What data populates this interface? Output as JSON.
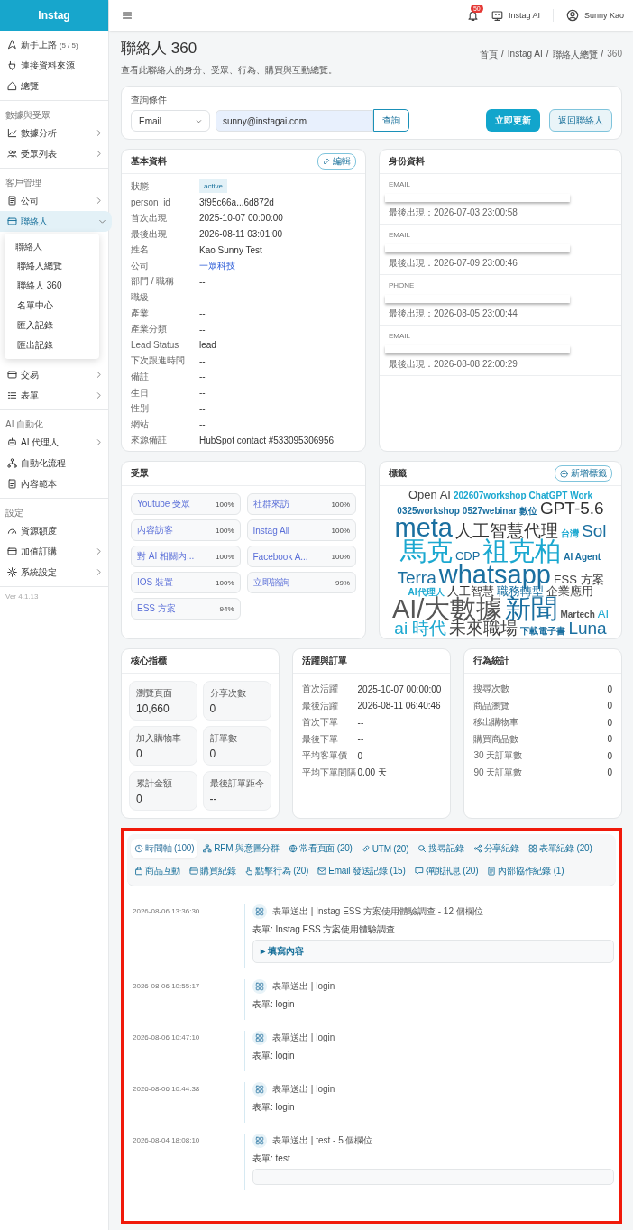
{
  "sidebar": {
    "brand": "Instag",
    "sections": [
      {
        "items": [
          {
            "label": "新手上路",
            "count": "(5 / 5)",
            "has_children": false,
            "selected": false
          },
          {
            "label": "連接資料來源",
            "has_children": false,
            "selected": false
          },
          {
            "label": "總覽",
            "has_children": false,
            "selected": false
          }
        ]
      },
      {
        "heading": "數據與受眾",
        "items": [
          {
            "label": "數據分析",
            "has_children": true,
            "expanded": false,
            "selected": false
          },
          {
            "label": "受眾列表",
            "has_children": true,
            "expanded": false,
            "selected": false
          }
        ]
      },
      {
        "heading": "客戶管理",
        "items": [
          {
            "label": "公司",
            "has_children": true,
            "expanded": false,
            "selected": false
          },
          {
            "label": "聯絡人",
            "has_children": true,
            "expanded": true,
            "selected": true,
            "submenu": {
              "heading": "聯絡人",
              "items": [
                "聯絡人總覽",
                "聯絡人 360",
                "名單中心",
                "匯入記錄",
                "匯出記錄"
              ]
            }
          },
          {
            "label": "交易",
            "has_children": true,
            "expanded": false,
            "selected": false
          },
          {
            "label": "表單",
            "has_children": true,
            "expanded": false,
            "selected": false
          }
        ]
      },
      {
        "heading": "AI 自動化",
        "items": [
          {
            "label": "AI 代理人",
            "has_children": true,
            "expanded": false,
            "selected": false
          },
          {
            "label": "自動化流程",
            "has_children": false,
            "selected": false
          },
          {
            "label": "內容範本",
            "has_children": false,
            "selected": false
          }
        ]
      },
      {
        "heading": "設定",
        "items": [
          {
            "label": "資源額度",
            "has_children": false,
            "selected": false
          },
          {
            "label": "加值訂購",
            "has_children": true,
            "expanded": false,
            "selected": false
          },
          {
            "label": "系統設定",
            "has_children": true,
            "expanded": false,
            "selected": false
          }
        ]
      }
    ],
    "version": "Ver 4.1.13"
  },
  "topbar": {
    "notification_count": "50",
    "workspace": "Instag AI",
    "user": "Sunny Kao"
  },
  "header": {
    "title": "聯絡人 360",
    "subtitle": "查看此聯絡人的身分、受眾、行為、購買與互動總覽。",
    "breadcrumb_separator": "/",
    "breadcrumb": [
      {
        "label": "首頁",
        "current": false
      },
      {
        "label": "Instag AI",
        "current": false
      },
      {
        "label": "聯絡人總覽",
        "current": false
      },
      {
        "label": "360",
        "current": true
      }
    ]
  },
  "query": {
    "label": "查詢條件",
    "field_type": "Email",
    "value": "sunny@instagai.com",
    "search_button": "查詢",
    "refresh_button": "立即更新",
    "back_button": "返回聯絡人"
  },
  "basic_info": {
    "title": "基本資料",
    "edit_button": "編輯",
    "rows": [
      {
        "label": "狀態",
        "value": "active",
        "kind": "badge"
      },
      {
        "label": "person_id",
        "value": "3f95c66a...6d872d",
        "kind": "text"
      },
      {
        "label": "首次出現",
        "value": "2025-10-07 00:00:00",
        "kind": "text"
      },
      {
        "label": "最後出現",
        "value": "2026-08-11 03:01:00",
        "kind": "text"
      },
      {
        "label": "姓名",
        "value": "Kao Sunny Test",
        "kind": "text"
      },
      {
        "label": "公司",
        "value": "一眾科技",
        "kind": "link"
      },
      {
        "label": "部門 / 職稱",
        "value": "--",
        "kind": "text"
      },
      {
        "label": "職級",
        "value": "--",
        "kind": "text"
      },
      {
        "label": "產業",
        "value": "--",
        "kind": "text"
      },
      {
        "label": "產業分類",
        "value": "--",
        "kind": "text"
      },
      {
        "label": "Lead Status",
        "value": "lead",
        "kind": "text"
      },
      {
        "label": "下次跟進時間",
        "value": "--",
        "kind": "text"
      },
      {
        "label": "備註",
        "value": "--",
        "kind": "text"
      },
      {
        "label": "生日",
        "value": "--",
        "kind": "text"
      },
      {
        "label": "性別",
        "value": "--",
        "kind": "text"
      },
      {
        "label": "網站",
        "value": "--",
        "kind": "text"
      },
      {
        "label": "來源備註",
        "value": "HubSpot contact #533095306956",
        "kind": "text"
      }
    ]
  },
  "identity": {
    "title": "身份資料",
    "entries": [
      {
        "type": "EMAIL",
        "last_seen": "最後出現：2026-07-03 23:00:58"
      },
      {
        "type": "EMAIL",
        "last_seen": "最後出現：2026-07-09 23:00:46"
      },
      {
        "type": "PHONE",
        "last_seen": "最後出現：2026-08-05 23:00:44"
      },
      {
        "type": "EMAIL",
        "last_seen": "最後出現：2026-08-08 22:00:29"
      }
    ]
  },
  "audiences": {
    "title": "受眾",
    "items": [
      {
        "name": "Youtube 受眾",
        "percent": "100%"
      },
      {
        "name": "社群來訪",
        "percent": "100%"
      },
      {
        "name": "內容訪客",
        "percent": "100%"
      },
      {
        "name": "Instag All",
        "percent": "100%"
      },
      {
        "name": "對 AI 相關內...",
        "percent": "100%"
      },
      {
        "name": "Facebook A...",
        "percent": "100%"
      },
      {
        "name": "IOS 裝置",
        "percent": "100%"
      },
      {
        "name": "立即諮詢",
        "percent": "99%"
      },
      {
        "name": "ESS 方案",
        "percent": "94%"
      }
    ]
  },
  "tags": {
    "title": "標籤",
    "add_button": "新增標籤",
    "cloud": [
      {
        "word": "Open AI",
        "kind": "m",
        "color": "#444444"
      },
      {
        "word": "202607workshop",
        "kind": "s",
        "color": "#1ba8d0"
      },
      {
        "word": "ChatGPT Work",
        "kind": "xs",
        "color": "#1ba8d0"
      },
      {
        "word": "0325workshop",
        "kind": "xs",
        "color": "#1a6fa0"
      },
      {
        "word": "0527webinar",
        "kind": "xs",
        "color": "#1a6fa0"
      },
      {
        "word": "數位",
        "kind": "s",
        "color": "#1a6fa0"
      },
      {
        "word": "GPT-5.6",
        "kind": "l",
        "color": "#333333"
      },
      {
        "word": "meta",
        "kind": "xl",
        "color": "#1a6fa0"
      },
      {
        "word": "人工智慧代理",
        "kind": "l",
        "color": "#333333"
      },
      {
        "word": "台灣",
        "kind": "s",
        "color": "#1ba8d0"
      },
      {
        "word": "Sol",
        "kind": "l",
        "color": "#1a6fa0"
      },
      {
        "word": "馬克",
        "kind": "xl",
        "color": "#1ba8d0"
      },
      {
        "word": "CDP",
        "kind": "m",
        "color": "#1a6fa0"
      },
      {
        "word": "祖克柏",
        "kind": "xl",
        "color": "#1ba8d0"
      },
      {
        "word": "AI Agent",
        "kind": "s",
        "color": "#1a6fa0"
      },
      {
        "word": "Terra",
        "kind": "l",
        "color": "#1a6fa0"
      },
      {
        "word": "whatsapp",
        "kind": "xl",
        "color": "#1a6fa0"
      },
      {
        "word": "ESS 方案",
        "kind": "m",
        "color": "#444444"
      },
      {
        "word": "AI代理人",
        "kind": "s",
        "color": "#1ba8d0"
      },
      {
        "word": "人工智慧",
        "kind": "m",
        "color": "#333333"
      },
      {
        "word": "職務轉型",
        "kind": "m",
        "color": "#1a6fa0"
      },
      {
        "word": "企業應用",
        "kind": "m",
        "color": "#444444"
      },
      {
        "word": "AI/大數據",
        "kind": "xl",
        "color": "#555555"
      },
      {
        "word": "新聞",
        "kind": "xl",
        "color": "#1a6fa0"
      },
      {
        "word": "Martech",
        "kind": "s",
        "color": "#555555"
      },
      {
        "word": "AI",
        "kind": "m",
        "color": "#1ba8d0"
      },
      {
        "word": "ai 時代",
        "kind": "l",
        "color": "#1ba8d0"
      },
      {
        "word": "未來職場",
        "kind": "l",
        "color": "#444444"
      },
      {
        "word": "下載電子書",
        "kind": "s",
        "color": "#1a6fa0"
      },
      {
        "word": "Luna",
        "kind": "l",
        "color": "#1a6fa0"
      }
    ]
  },
  "core_metrics": {
    "title": "核心指標",
    "tiles": [
      {
        "label": "瀏覽頁面",
        "value": "10,660"
      },
      {
        "label": "分享次數",
        "value": "0"
      },
      {
        "label": "加入購物車",
        "value": "0"
      },
      {
        "label": "訂單數",
        "value": "0"
      },
      {
        "label": "累計金額",
        "value": "0"
      },
      {
        "label": "最後訂單距今",
        "value": "--"
      }
    ]
  },
  "activity": {
    "title": "活躍與訂單",
    "rows": [
      {
        "label": "首次活躍",
        "value": "2025-10-07 00:00:00"
      },
      {
        "label": "最後活躍",
        "value": "2026-08-11 06:40:46"
      },
      {
        "label": "首次下單",
        "value": "--"
      },
      {
        "label": "最後下單",
        "value": "--"
      },
      {
        "label": "平均客單價",
        "value": "0"
      },
      {
        "label": "平均下單間隔",
        "value": "0.00 天"
      }
    ]
  },
  "behavior": {
    "title": "行為統計",
    "rows": [
      {
        "label": "搜尋次數",
        "value": "0"
      },
      {
        "label": "商品瀏覽",
        "value": "0"
      },
      {
        "label": "移出購物車",
        "value": "0"
      },
      {
        "label": "購買商品數",
        "value": "0"
      },
      {
        "label": "30 天訂單數",
        "value": "0"
      },
      {
        "label": "90 天訂單數",
        "value": "0"
      }
    ]
  },
  "timeline": {
    "highlighted": true,
    "tabs": [
      {
        "label": "時間軸 (100)",
        "selected": true
      },
      {
        "label": "RFM 與意圖分群",
        "selected": false
      },
      {
        "label": "常看頁面 (20)",
        "selected": false
      },
      {
        "label": "UTM (20)",
        "selected": false
      },
      {
        "label": "搜尋記錄",
        "selected": false
      },
      {
        "label": "分享紀錄",
        "selected": false
      },
      {
        "label": "表單紀錄 (20)",
        "selected": false
      },
      {
        "label": "商品互動",
        "selected": false
      },
      {
        "label": "購買紀錄",
        "selected": false
      },
      {
        "label": "點擊行為 (20)",
        "selected": false
      },
      {
        "label": "Email 發送記錄 (15)",
        "selected": false
      },
      {
        "label": "彈跳訊息 (20)",
        "selected": false
      },
      {
        "label": "內部協作紀錄 (1)",
        "selected": false
      }
    ],
    "events": [
      {
        "time": "2026-08-06 13:36:30",
        "title": "表單送出 | Instag ESS 方案使用體驗調查 - 12 個欄位",
        "detail": "表單: Instag ESS 方案使用體驗調查",
        "details": "▸ 填寫內容"
      },
      {
        "time": "2026-08-06 10:55:17",
        "title": "表單送出 | login",
        "detail": "表單: login"
      },
      {
        "time": "2026-08-06 10:47:10",
        "title": "表單送出 | login",
        "detail": "表單: login"
      },
      {
        "time": "2026-08-06 10:44:38",
        "title": "表單送出 | login",
        "detail": "表單: login"
      },
      {
        "time": "2026-08-04 18:08:10",
        "title": "表單送出 | test - 5 個欄位",
        "detail": "表單: test",
        "details_cut": true
      }
    ]
  }
}
